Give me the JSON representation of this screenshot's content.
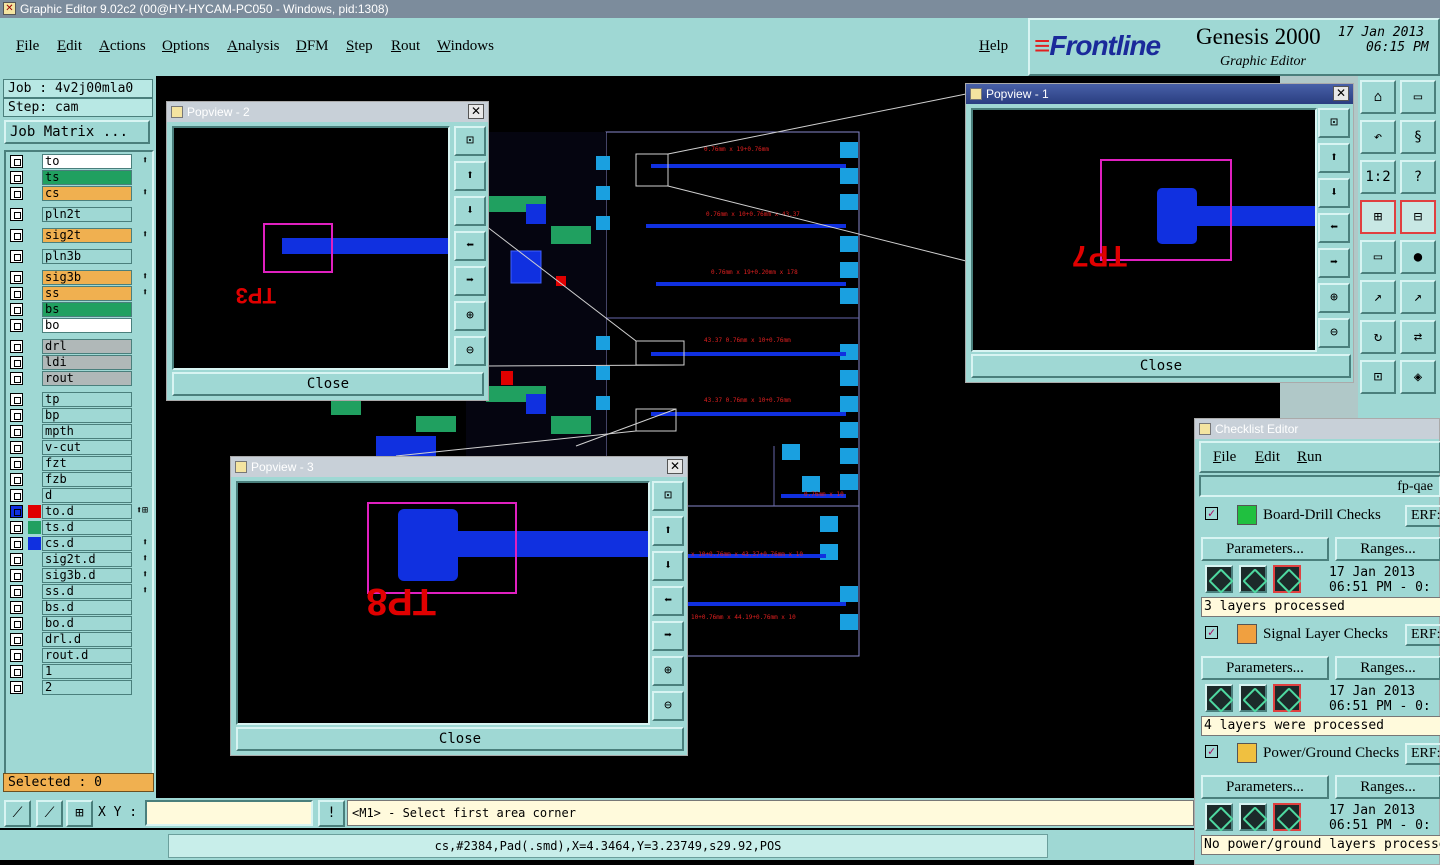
{
  "window": {
    "title": "Graphic Editor 9.02c2 (00@HY-HYCAM-PC050 - Windows, pid:1308)"
  },
  "menu": [
    "File",
    "Edit",
    "Actions",
    "Options",
    "Analysis",
    "DFM",
    "Step",
    "Rout",
    "Windows"
  ],
  "help_label": "Help",
  "brand": {
    "logo": "Frontline",
    "product": "Genesis 2000",
    "subtitle": "Graphic Editor",
    "date": "17 Jan 2013",
    "time": "06:15 PM"
  },
  "job": "Job : 4v2j00mla0",
  "step": "Step: cam",
  "job_matrix_label": "Job Matrix ...",
  "layers": [
    {
      "name": "to",
      "color": "#ffffff",
      "flag": "⬆"
    },
    {
      "name": "ts",
      "color": "#20a060",
      "flag": ""
    },
    {
      "name": "cs",
      "color": "#f0b050",
      "flag": "⬆"
    },
    {
      "name": "pln2t",
      "color": "#9fd8d4",
      "flag": ""
    },
    {
      "name": "sig2t",
      "color": "#f0b050",
      "flag": "⬆"
    },
    {
      "name": "pln3b",
      "color": "#9fd8d4",
      "flag": ""
    },
    {
      "name": "sig3b",
      "color": "#f0b050",
      "flag": "⬆"
    },
    {
      "name": "ss",
      "color": "#f0b050",
      "flag": "⬆"
    },
    {
      "name": "bs",
      "color": "#20a060",
      "flag": ""
    },
    {
      "name": "bo",
      "color": "#ffffff",
      "flag": ""
    },
    {
      "name": "drl",
      "color": "#b0b8b8",
      "flag": ""
    },
    {
      "name": "ldi",
      "color": "#b0b8b8",
      "flag": ""
    },
    {
      "name": "rout",
      "color": "#b0b8b8",
      "flag": ""
    },
    {
      "name": "tp",
      "color": "#9fd8d4",
      "flag": ""
    },
    {
      "name": "bp",
      "color": "#9fd8d4",
      "flag": ""
    },
    {
      "name": "mpth",
      "color": "#9fd8d4",
      "flag": ""
    },
    {
      "name": "v-cut",
      "color": "#9fd8d4",
      "flag": ""
    },
    {
      "name": "fzt",
      "color": "#9fd8d4",
      "flag": ""
    },
    {
      "name": "fzb",
      "color": "#9fd8d4",
      "flag": ""
    },
    {
      "name": "d",
      "color": "#9fd8d4",
      "flag": ""
    },
    {
      "name": "to.d",
      "color": "#9fd8d4",
      "flag": "⬆⊞",
      "swatch": "#e00000",
      "checked": true
    },
    {
      "name": "ts.d",
      "color": "#9fd8d4",
      "flag": "",
      "swatch": "#20a060"
    },
    {
      "name": "cs.d",
      "color": "#9fd8d4",
      "flag": "⬆",
      "swatch": "#1030e0"
    },
    {
      "name": "sig2t.d",
      "color": "#9fd8d4",
      "flag": "⬆"
    },
    {
      "name": "sig3b.d",
      "color": "#9fd8d4",
      "flag": "⬆"
    },
    {
      "name": "ss.d",
      "color": "#9fd8d4",
      "flag": "⬆"
    },
    {
      "name": "bs.d",
      "color": "#9fd8d4",
      "flag": ""
    },
    {
      "name": "bo.d",
      "color": "#9fd8d4",
      "flag": ""
    },
    {
      "name": "drl.d",
      "color": "#9fd8d4",
      "flag": ""
    },
    {
      "name": "rout.d",
      "color": "#9fd8d4",
      "flag": ""
    },
    {
      "name": "1",
      "color": "#9fd8d4",
      "flag": ""
    },
    {
      "name": "2",
      "color": "#9fd8d4",
      "flag": ""
    }
  ],
  "selected": "Selected : 0",
  "popviews": {
    "p1": {
      "title": "Popview - 1",
      "label": "TP7",
      "close": "Close"
    },
    "p2": {
      "title": "Popview - 2",
      "label": "TP3",
      "close": "Close"
    },
    "p3": {
      "title": "Popview - 3",
      "label": "TP8",
      "close": "Close"
    }
  },
  "checklist": {
    "title": "Checklist Editor",
    "menu": [
      "File",
      "Edit",
      "Run"
    ],
    "name": "fp-qae",
    "sections": [
      {
        "label": "Board-Drill Checks",
        "erf": "ERF:",
        "params": "Parameters...",
        "ranges": "Ranges...",
        "date": "17 Jan 2013",
        "time": "06:51 PM - 0:",
        "status": "3 layers processed",
        "icon_color": "#20c040"
      },
      {
        "label": "Signal Layer Checks",
        "erf": "ERF:",
        "params": "Parameters...",
        "ranges": "Ranges...",
        "date": "17 Jan 2013",
        "time": "06:51 PM - 0:",
        "status": "4 layers were processed",
        "icon_color": "#f0a040"
      },
      {
        "label": "Power/Ground Checks",
        "erf": "ERF:",
        "params": "Parameters...",
        "ranges": "Ranges...",
        "date": "17 Jan 2013",
        "time": "06:51 PM - 0:",
        "status": "No power/ground layers processed",
        "icon_color": "#f0c040"
      }
    ]
  },
  "bottom": {
    "xy_label": "X Y :",
    "xy_value": "",
    "prompt": "<M1> - Select first area corner",
    "status": "cs,#2384,Pad(.smd),X=4.3464,Y=3.23749,s29.92,POS"
  },
  "pcb_labels": [
    "0.76mm x 19+0.76mm",
    "0.76mm x 10+0.76mm x 43.37",
    "0.76mm x 19+0.20mm x 178",
    "43.37 0.76mm x 10+0.76mm",
    "43.37 0.76mm x 10+0.76mm",
    "0.76mm x 10",
    "x 10+0.76mm x 43.37+0.76mm x 10",
    "10+0.76mm x 44.19+0.76mm x 10",
    "TP7",
    "TP3",
    "TP8"
  ]
}
